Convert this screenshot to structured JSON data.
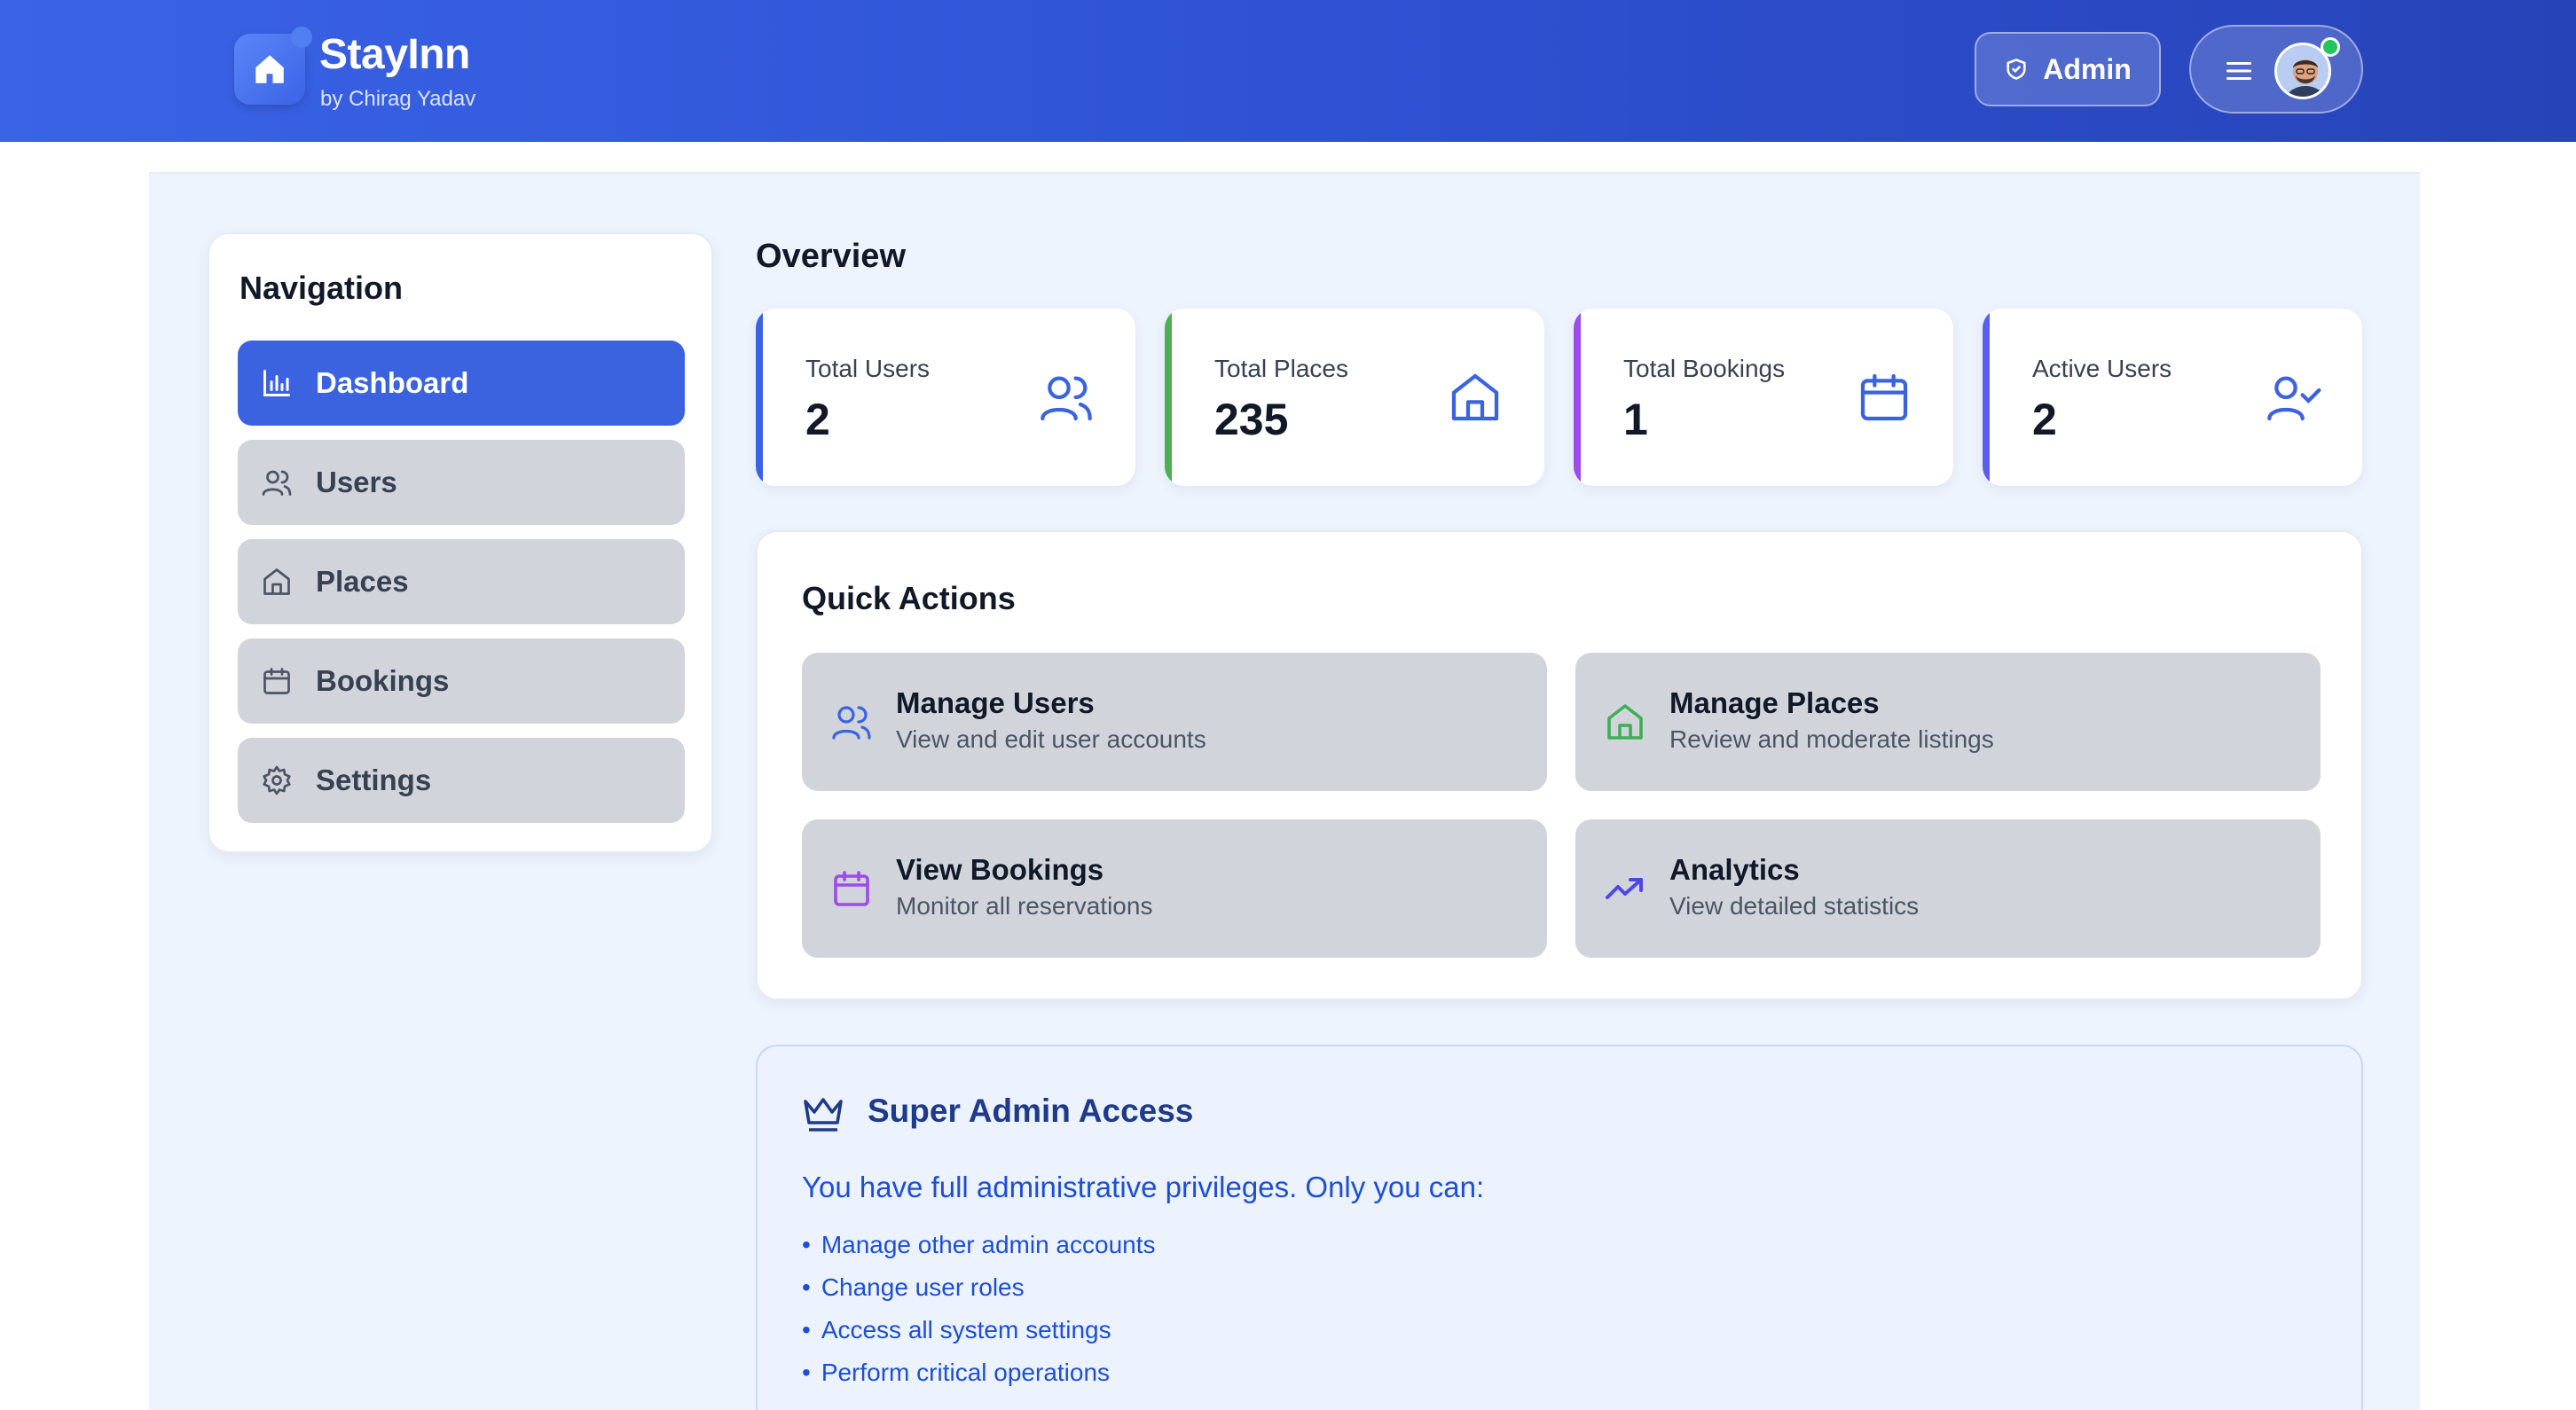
{
  "brand": {
    "name": "StayInn",
    "subtitle": "by Chirag Yadav",
    "icon": "home-icon"
  },
  "header": {
    "admin_label": "Admin",
    "admin_icon": "shield-icon",
    "menu_icon": "hamburger-icon",
    "avatar": "user-avatar",
    "online_status_color": "#22c55e"
  },
  "sidebar": {
    "title": "Navigation",
    "items": [
      {
        "label": "Dashboard",
        "icon": "bar-chart-icon",
        "active": true
      },
      {
        "label": "Users",
        "icon": "users-icon",
        "active": false
      },
      {
        "label": "Places",
        "icon": "home-icon",
        "active": false
      },
      {
        "label": "Bookings",
        "icon": "calendar-icon",
        "active": false
      },
      {
        "label": "Settings",
        "icon": "gear-icon",
        "active": false
      }
    ]
  },
  "overview": {
    "title": "Overview",
    "stats": [
      {
        "label": "Total Users",
        "value": "2",
        "icon": "users-icon",
        "accent": "#3b63e0"
      },
      {
        "label": "Total Places",
        "value": "235",
        "icon": "home-icon",
        "accent": "#4caf50"
      },
      {
        "label": "Total Bookings",
        "value": "1",
        "icon": "calendar-icon",
        "accent": "#9b4de6"
      },
      {
        "label": "Active Users",
        "value": "2",
        "icon": "user-check-icon",
        "accent": "#5b5ee6"
      }
    ]
  },
  "quick_actions": {
    "title": "Quick Actions",
    "items": [
      {
        "title": "Manage Users",
        "subtitle": "View and edit user accounts",
        "icon": "users-icon",
        "color": "#3b63e0"
      },
      {
        "title": "Manage Places",
        "subtitle": "Review and moderate listings",
        "icon": "home-icon",
        "color": "#3fae54"
      },
      {
        "title": "View Bookings",
        "subtitle": "Monitor all reservations",
        "icon": "calendar-icon",
        "color": "#9b4de6"
      },
      {
        "title": "Analytics",
        "subtitle": "View detailed statistics",
        "icon": "trending-up-icon",
        "color": "#4f46e5"
      }
    ]
  },
  "super_admin": {
    "title": "Super Admin Access",
    "icon": "crown-icon",
    "description": "You have full administrative privileges. Only you can:",
    "items": [
      "Manage other admin accounts",
      "Change user roles",
      "Access all system settings",
      "Perform critical operations"
    ]
  }
}
